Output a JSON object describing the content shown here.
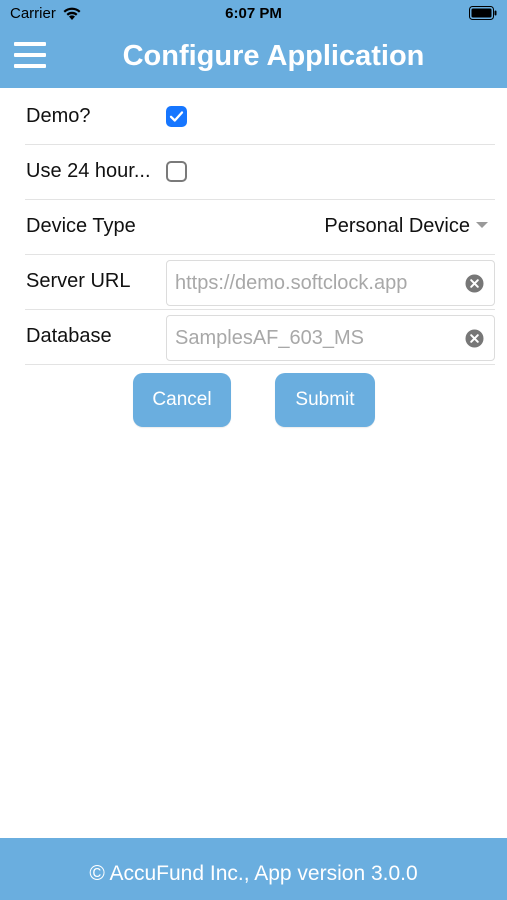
{
  "status_bar": {
    "carrier": "Carrier",
    "time": "6:07 PM"
  },
  "header": {
    "title": "Configure Application",
    "menu_icon": "hamburger-menu-icon",
    "color": "#6aaedf"
  },
  "form": {
    "demo": {
      "label": "Demo?",
      "checked": true
    },
    "use_24_hour": {
      "label": "Use 24 hour...",
      "checked": false
    },
    "device_type": {
      "label": "Device Type",
      "value": "Personal Device"
    },
    "server_url": {
      "label": "Server URL",
      "value": "",
      "placeholder": "https://demo.softclock.app"
    },
    "database": {
      "label": "Database",
      "value": "",
      "placeholder": "SamplesAF_603_MS"
    }
  },
  "buttons": {
    "cancel": "Cancel",
    "submit": "Submit"
  },
  "footer": {
    "text": "© AccuFund Inc., App version 3.0.0"
  },
  "colors": {
    "accent": "#6aaedf",
    "checkbox_checked": "#1676ff"
  }
}
